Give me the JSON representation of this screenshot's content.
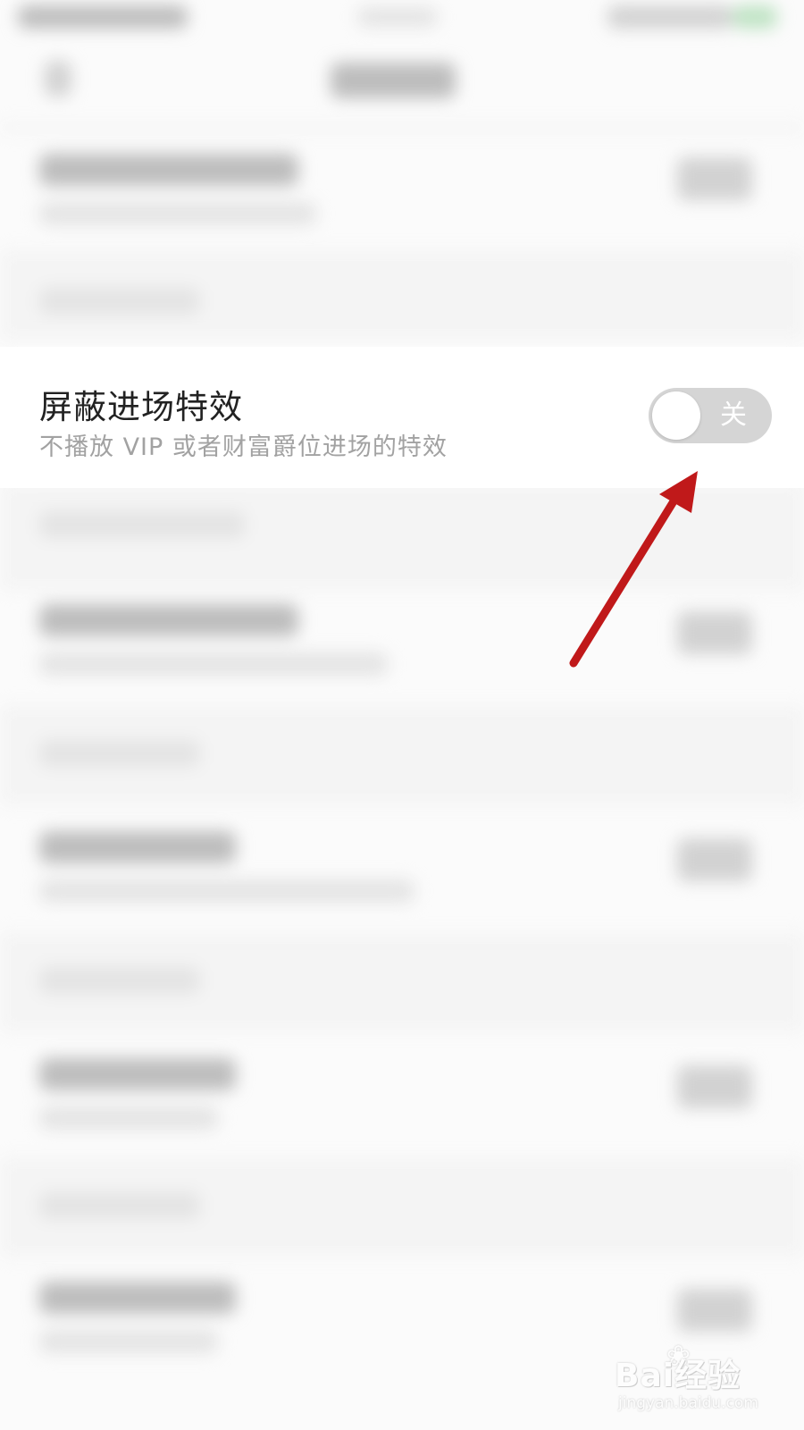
{
  "setting": {
    "title": "屏蔽进场特效",
    "description": "不播放 VIP 或者财富爵位进场的特效",
    "toggle": {
      "state": "off",
      "label": "关",
      "color_off": "#d5d5d5"
    }
  },
  "annotation": {
    "arrow_color": "#c0191a",
    "arrow_icon": "red-arrow-icon"
  },
  "watermark": {
    "logo": "Bai经验",
    "url": "jingyan.baidu.com"
  }
}
